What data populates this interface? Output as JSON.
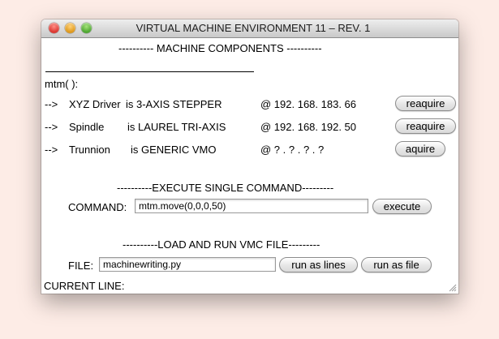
{
  "window": {
    "title": "VIRTUAL MACHINE ENVIRONMENT 11 – REV. 1"
  },
  "components": {
    "header": "---------- MACHINE COMPONENTS ----------",
    "mtm_label": "mtm( ):",
    "rows": [
      {
        "arrow": "-->",
        "name": "XYZ Driver",
        "is_text": "is 3-AXIS STEPPER",
        "address": "@ 192. 168. 183. 66",
        "button": "reaquire"
      },
      {
        "arrow": "-->",
        "name": "Spindle",
        "is_text": "is LAUREL TRI-AXIS",
        "address": "@ 192. 168. 192. 50",
        "button": "reaquire"
      },
      {
        "arrow": "-->",
        "name": "Trunnion",
        "is_text": "is GENERIC VMO",
        "address": "@ ? . ? . ? . ?",
        "button": "aquire"
      }
    ]
  },
  "execute": {
    "header": "----------EXECUTE SINGLE COMMAND---------",
    "label": "COMMAND:",
    "value": "mtm.move(0,0,0,50)",
    "button": "execute"
  },
  "file": {
    "header": "----------LOAD AND RUN VMC FILE---------",
    "label": "FILE:",
    "value": "machinewriting.py",
    "run_lines": "run as lines",
    "run_file": "run as file"
  },
  "status": {
    "current_line_label": "CURRENT LINE:"
  }
}
